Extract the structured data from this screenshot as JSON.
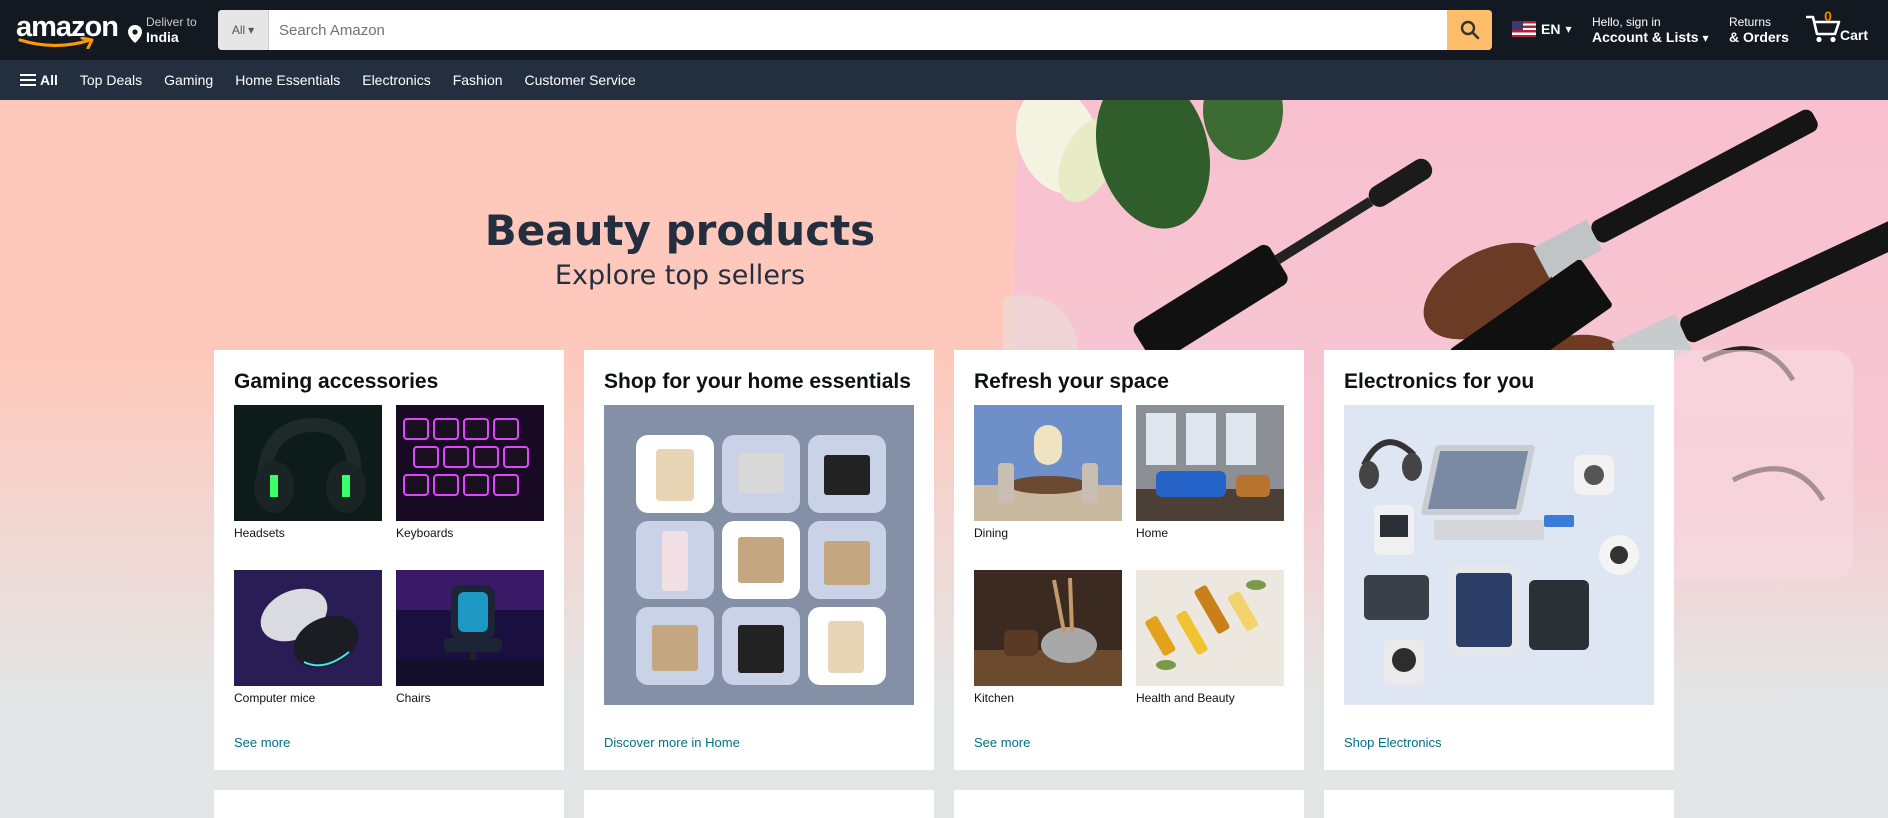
{
  "header": {
    "logo_text": "amazon",
    "deliver_line1": "Deliver to",
    "deliver_line2": "India",
    "search_category": "All",
    "search_placeholder": "Search Amazon",
    "language": "EN",
    "account_line1": "Hello, sign in",
    "account_line2": "Account & Lists",
    "returns_line1": "Returns",
    "returns_line2": "& Orders",
    "cart_count": "0",
    "cart_label": "Cart"
  },
  "subnav": {
    "all_label": "All",
    "items": [
      "Top Deals",
      "Gaming",
      "Home Essentials",
      "Electronics",
      "Fashion",
      "Customer Service"
    ]
  },
  "hero": {
    "title": "Beauty products",
    "subtitle": "Explore top sellers"
  },
  "cards": [
    {
      "title": "Gaming accessories",
      "tiles": [
        "Headsets",
        "Keyboards",
        "Computer mice",
        "Chairs"
      ],
      "link": "See more"
    },
    {
      "title": "Shop for your home essentials",
      "link": "Discover more in Home"
    },
    {
      "title": "Refresh your space",
      "tiles": [
        "Dining",
        "Home",
        "Kitchen",
        "Health and Beauty"
      ],
      "link": "See more"
    },
    {
      "title": "Electronics for you",
      "link": "Shop Electronics"
    }
  ],
  "colors": {
    "nav_bg": "#131921",
    "subnav_bg": "#232f3e",
    "search_button": "#febd69",
    "link": "#007185",
    "hero_bg": "#fec9bc",
    "cart_count": "#f08804"
  }
}
